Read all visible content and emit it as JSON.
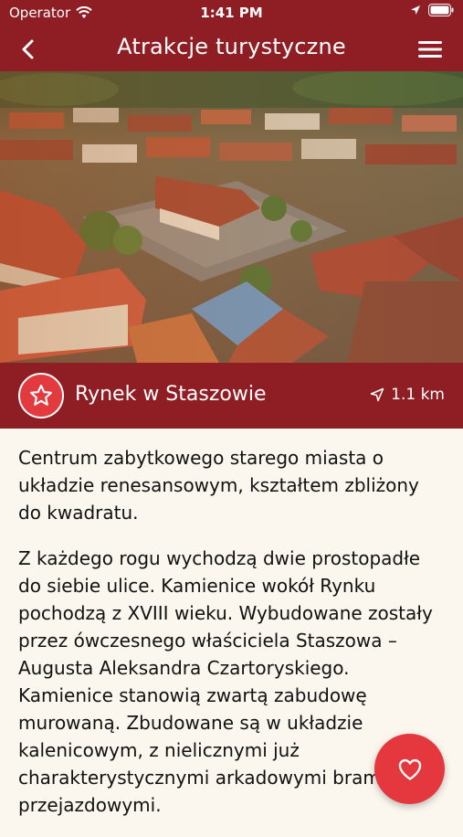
{
  "status_bar": {
    "carrier": "Operator",
    "time": "1:41 PM"
  },
  "nav": {
    "title": "Atrakcje turystyczne",
    "back_icon": "chevron-left-icon",
    "menu_icon": "hamburger-menu-icon"
  },
  "hero": {
    "image_description": "aerial-town-square-photo"
  },
  "place": {
    "name": "Rynek w Staszowie",
    "distance": "1.1 km",
    "icon": "star-icon"
  },
  "description": {
    "paragraphs": [
      "Centrum zabytkowego starego miasta o układzie renesansowym, kształtem zbliżony do kwadratu.",
      "Z każdego rogu wychodzą dwie prostopadłe do siebie ulice. Kamienice wokół Rynku pochodzą z XVIII wieku. Wybudowane zostały przez ówczesnego właściciela Staszowa – Augusta Aleksandra Czartoryskiego. Kamienice stanowią zwartą zabudowę murowaną. Zbudowane są w układzie kalenicowym, z nielicznymi już charakterystycznymi arkadowymi bramami przejazdowymi."
    ]
  },
  "colors": {
    "brand": "#8f1d24",
    "accent": "#e4383e",
    "background": "#fbf7ef"
  }
}
